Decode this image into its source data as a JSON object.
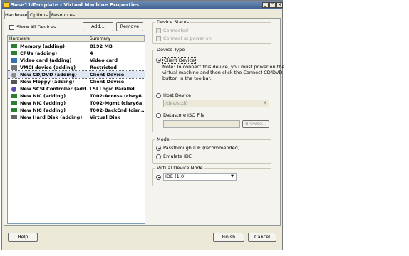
{
  "window": {
    "title": "Suse11-Template - Virtual Machine Properties"
  },
  "tabs": [
    "Hardware",
    "Options",
    "Resources"
  ],
  "left": {
    "show_all_label": "Show All Devices",
    "add_label": "Add...",
    "remove_label": "Remove",
    "columns": [
      "Hardware",
      "Summary"
    ],
    "rows": [
      {
        "hardware": "Memory (adding)",
        "summary": "8192 MB",
        "icon": "memory-icon",
        "color": "#2e7d32"
      },
      {
        "hardware": "CPUs (adding)",
        "summary": "4",
        "icon": "cpu-icon",
        "color": "#2e7d32"
      },
      {
        "hardware": "Video card (adding)",
        "summary": "Video card",
        "icon": "video-card-icon",
        "color": "#3a6fb0"
      },
      {
        "hardware": "VMCI device (adding)",
        "summary": "Restricted",
        "icon": "vmci-icon",
        "color": "#777777"
      },
      {
        "hardware": "New CD/DVD (adding)",
        "summary": "Client Device",
        "icon": "cd-dvd-icon",
        "color": "#8a8a8a"
      },
      {
        "hardware": "New Floppy (adding)",
        "summary": "Client Device",
        "icon": "floppy-icon",
        "color": "#555555"
      },
      {
        "hardware": "New SCSI Controller (add...",
        "summary": "LSI Logic Parallel",
        "icon": "scsi-icon",
        "color": "#5a4fb0"
      },
      {
        "hardware": "New NIC (adding)",
        "summary": "T002-Access (cisry6...",
        "icon": "nic-icon",
        "color": "#2e7d32"
      },
      {
        "hardware": "New NIC (adding)",
        "summary": "T002-Mgmt (cisry6a...",
        "icon": "nic-icon",
        "color": "#2e7d32"
      },
      {
        "hardware": "New NIC (adding)",
        "summary": "T002-BackEnd (cisr...",
        "icon": "nic-icon",
        "color": "#2e7d32"
      },
      {
        "hardware": "New Hard Disk (adding)",
        "summary": "Virtual Disk",
        "icon": "hard-disk-icon",
        "color": "#666666"
      }
    ]
  },
  "device_status": {
    "title": "Device Status",
    "connected_label": "Connected",
    "connect_power_label": "Connect at power on"
  },
  "device_type": {
    "title": "Device Type",
    "client_label": "Client Device",
    "note": [
      "Note: To connect this device, you must power on the",
      "virtual machine and then click the Connect CD/DVD",
      "button in the toolbar."
    ],
    "host_label": "Host Device",
    "host_value": "/dev/scd0",
    "datastore_label": "Datastore ISO File",
    "browse_label": "Browse..."
  },
  "mode": {
    "title": "Mode",
    "passthrough_label": "Passthrough IDE (recommended)",
    "emulate_label": "Emulate IDE"
  },
  "vdn": {
    "title": "Virtual Device Node",
    "value": "IDE (1:0)"
  },
  "footer": {
    "help": "Help",
    "finish": "Finish",
    "cancel": "Cancel"
  }
}
